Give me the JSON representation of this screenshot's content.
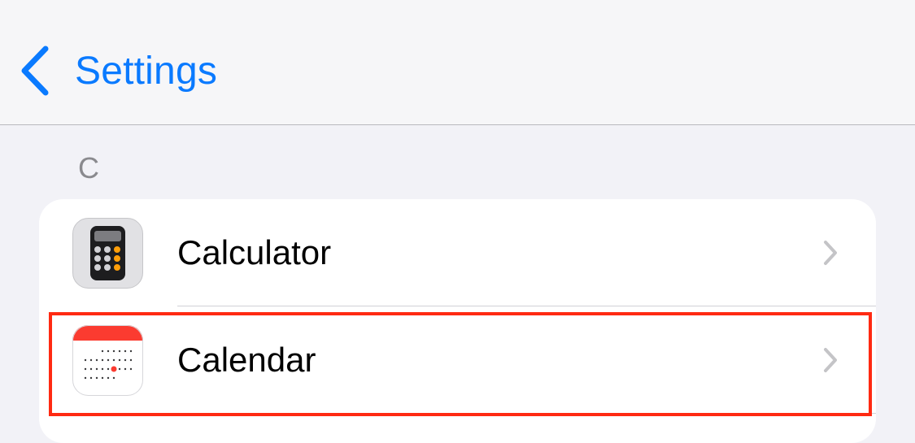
{
  "navbar": {
    "back_label": "Settings"
  },
  "section": {
    "header": "C"
  },
  "apps": [
    {
      "label": "Calculator",
      "icon": "calculator-icon"
    },
    {
      "label": "Calendar",
      "icon": "calendar-icon"
    }
  ],
  "colors": {
    "accent": "#0a7aff",
    "highlight": "#ff2a12",
    "background": "#f2f2f7"
  }
}
